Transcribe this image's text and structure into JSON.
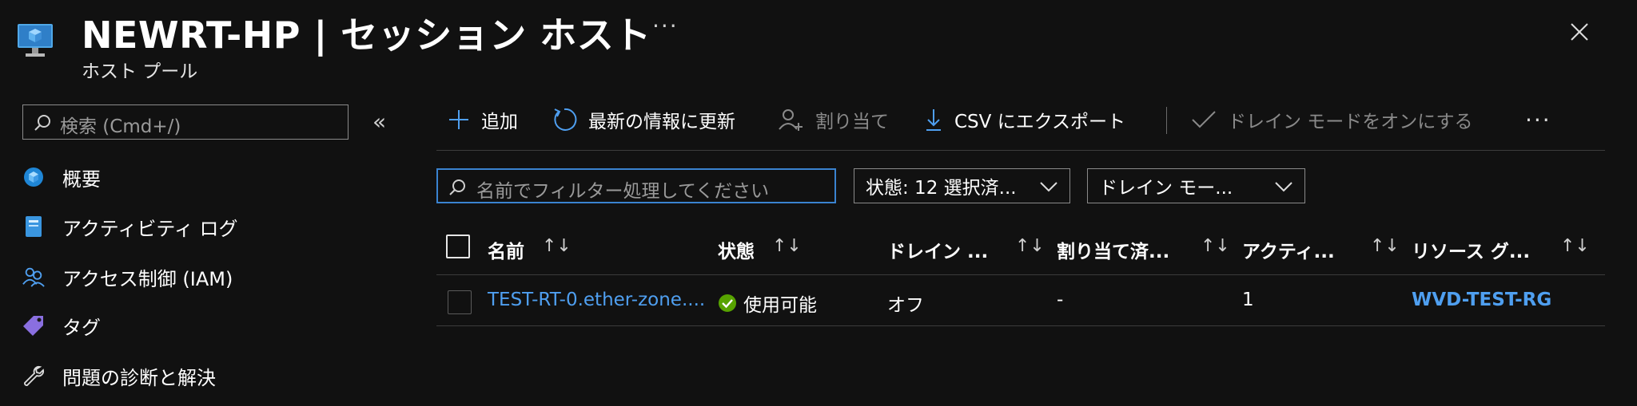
{
  "header": {
    "title": "NEWRT-HP | セッション ホスト",
    "subtitle": "ホスト プール",
    "more": "···"
  },
  "sidebar": {
    "search_placeholder": "検索 (Cmd+/)",
    "collapse": "«",
    "items": [
      {
        "label": "概要",
        "icon": "overview-icon"
      },
      {
        "label": "アクティビティ ログ",
        "icon": "activity-log-icon"
      },
      {
        "label": "アクセス制御 (IAM)",
        "icon": "iam-icon"
      },
      {
        "label": "タグ",
        "icon": "tag-icon"
      },
      {
        "label": "問題の診断と解決",
        "icon": "wrench-icon"
      }
    ]
  },
  "toolbar": {
    "add": "追加",
    "refresh": "最新の情報に更新",
    "assign": "割り当て",
    "export_csv": "CSV にエクスポート",
    "drain_mode_on": "ドレイン モードをオンにする",
    "more": "···"
  },
  "filters": {
    "name_placeholder": "名前でフィルター処理してください",
    "status": "状態: 12 選択済...",
    "drain_mode": "ドレイン モー..."
  },
  "table": {
    "columns": [
      "名前",
      "状態",
      "ドレイン ...",
      "割り当て済...",
      "アクティ...",
      "リソース グ..."
    ],
    "sort_glyph": "↑↓",
    "rows": [
      {
        "name": "TEST-RT-0.ether-zone....",
        "status": "使用可能",
        "drain": "オフ",
        "assigned": "-",
        "active": "1",
        "resource_group": "WVD-TEST-RG"
      }
    ]
  },
  "colors": {
    "background": "#111111",
    "link": "#4f9ff0",
    "accent": "#3a83d0",
    "success": "#57a300"
  }
}
